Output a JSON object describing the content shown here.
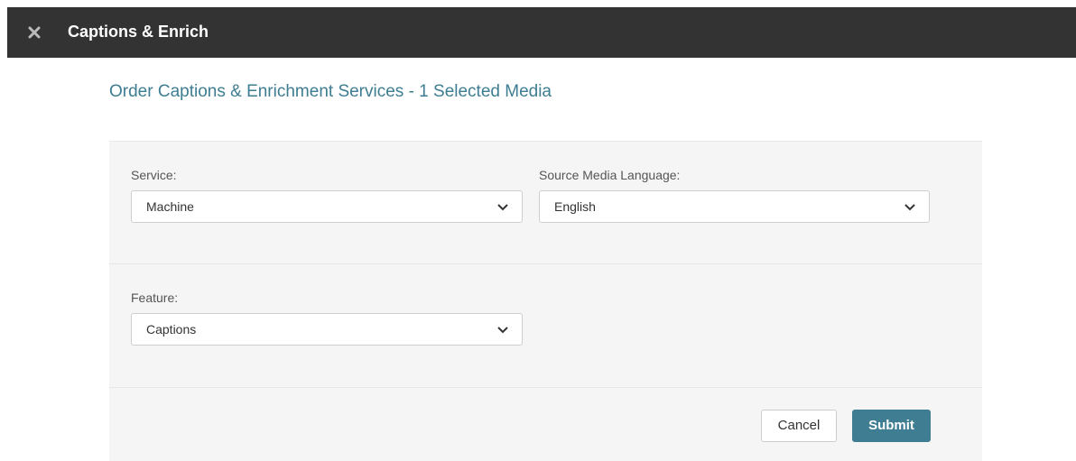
{
  "topbar": {
    "title": "Captions & Enrich",
    "close_icon": "close-icon"
  },
  "heading": "Order Captions & Enrichment Services - 1 Selected Media",
  "form": {
    "service": {
      "label": "Service:",
      "value": "Machine"
    },
    "source_language": {
      "label": "Source Media Language:",
      "value": "English"
    },
    "feature": {
      "label": "Feature:",
      "value": "Captions"
    }
  },
  "actions": {
    "cancel_label": "Cancel",
    "submit_label": "Submit"
  },
  "colors": {
    "topbar_bg": "#333333",
    "accent": "#3e7d92",
    "panel_bg": "#f5f5f5"
  }
}
